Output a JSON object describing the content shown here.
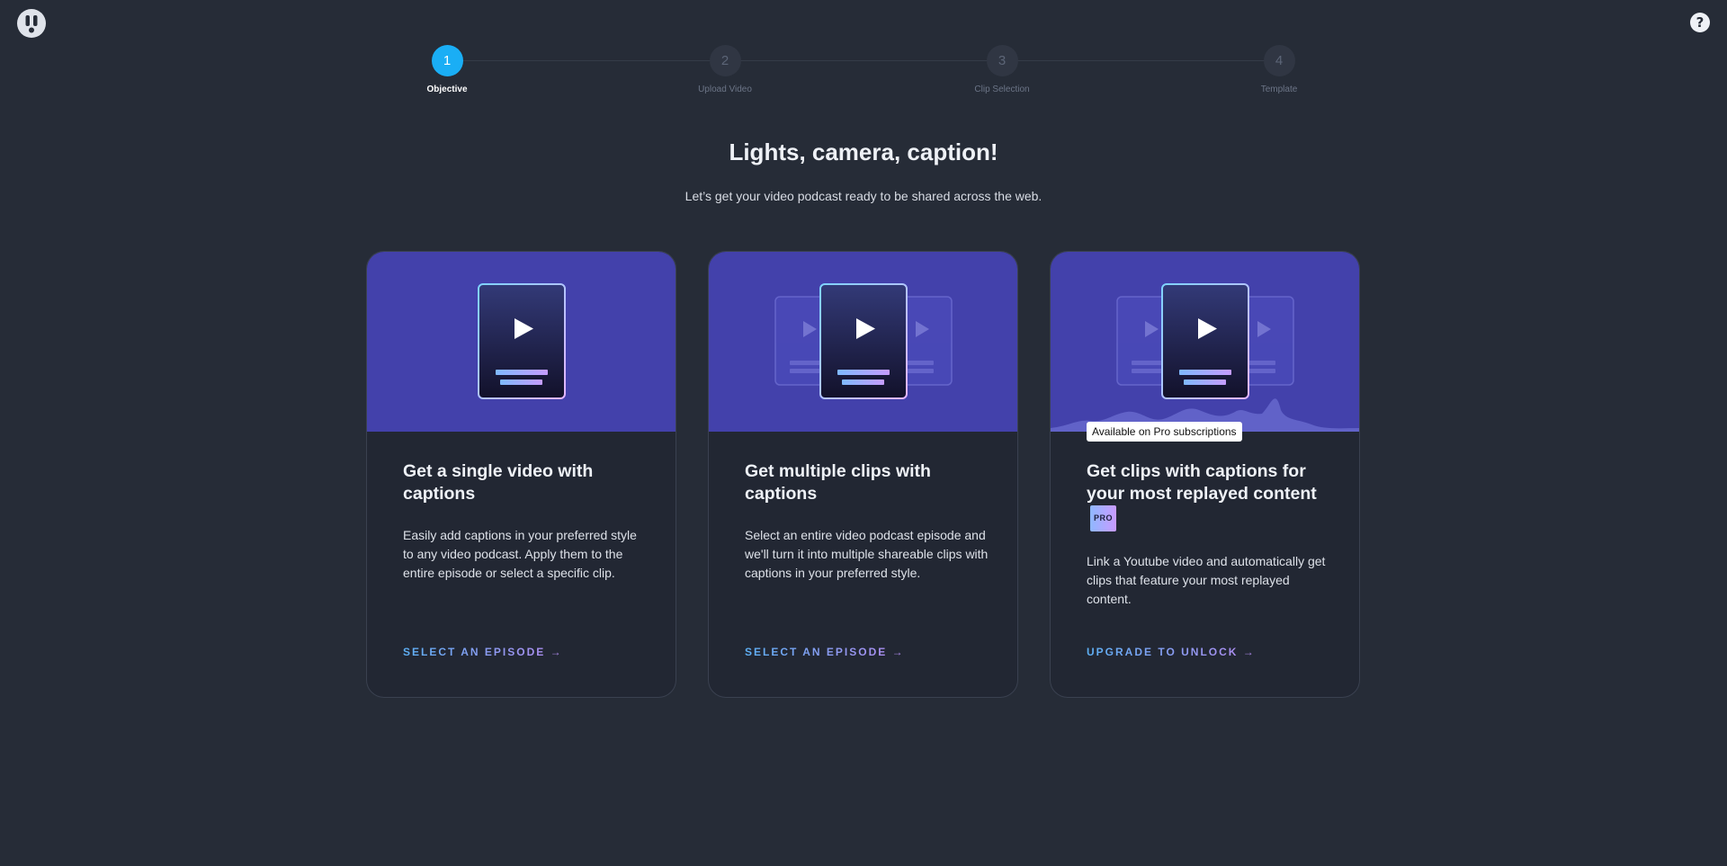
{
  "icons": {
    "logo": "exclamation-logo-icon",
    "help": "question-mark-icon",
    "play": "play-icon"
  },
  "colors": {
    "background": "#262c37",
    "step_active": "#1aaef5",
    "card_hero": "#4341ab",
    "card_body": "#222733",
    "cta_gradient_start": "#5db0f5",
    "cta_gradient_end": "#b48af0"
  },
  "help": {
    "label": "?"
  },
  "stepper": {
    "steps": [
      {
        "number": "1",
        "label": "Objective",
        "active": true
      },
      {
        "number": "2",
        "label": "Upload Video",
        "active": false
      },
      {
        "number": "3",
        "label": "Clip Selection",
        "active": false
      },
      {
        "number": "4",
        "label": "Template",
        "active": false
      }
    ]
  },
  "hero": {
    "title": "Lights, camera, caption!",
    "subtitle": "Let’s get your video podcast ready to be shared across the web."
  },
  "cards": [
    {
      "title": "Get a single video with captions",
      "description": "Easily add captions in your preferred style to any video podcast. Apply them to the entire episode or select a specific clip.",
      "cta": "SELECT AN EPISODE →"
    },
    {
      "title": "Get multiple clips with captions",
      "description": "Select an entire video podcast episode and we'll turn it into multiple shareable clips with captions in your preferred style.",
      "cta": "SELECT AN EPISODE →"
    },
    {
      "title": "Get clips with captions for your most replayed content",
      "badge": "PRO",
      "tooltip": "Available on Pro subscriptions",
      "description": "Link a Youtube video and automatically get clips that feature your most replayed content.",
      "cta": "UPGRADE TO UNLOCK →"
    }
  ]
}
